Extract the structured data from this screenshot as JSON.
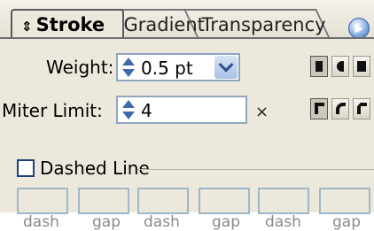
{
  "tabs": [
    {
      "label": "Stroke",
      "active": true
    },
    {
      "label": "Gradient",
      "active": false
    },
    {
      "label": "Transparency",
      "active": false
    }
  ],
  "weight": {
    "label": "Weight:",
    "value": "0.5 pt"
  },
  "miter": {
    "label": "Miter Limit:",
    "value": "4",
    "suffix": "×"
  },
  "dashed": {
    "label": "Dashed Line",
    "checked": false
  },
  "dash_labels": [
    "dash",
    "gap",
    "dash",
    "gap",
    "dash",
    "gap"
  ],
  "icons": {
    "cap_buttons": [
      "butt-cap-icon",
      "round-cap-icon",
      "projecting-cap-icon"
    ],
    "join_buttons": [
      "miter-join-icon",
      "round-join-icon",
      "bevel-join-icon"
    ]
  },
  "colors": {
    "panel": "#ece9dc",
    "accent": "#3f6aa8"
  }
}
